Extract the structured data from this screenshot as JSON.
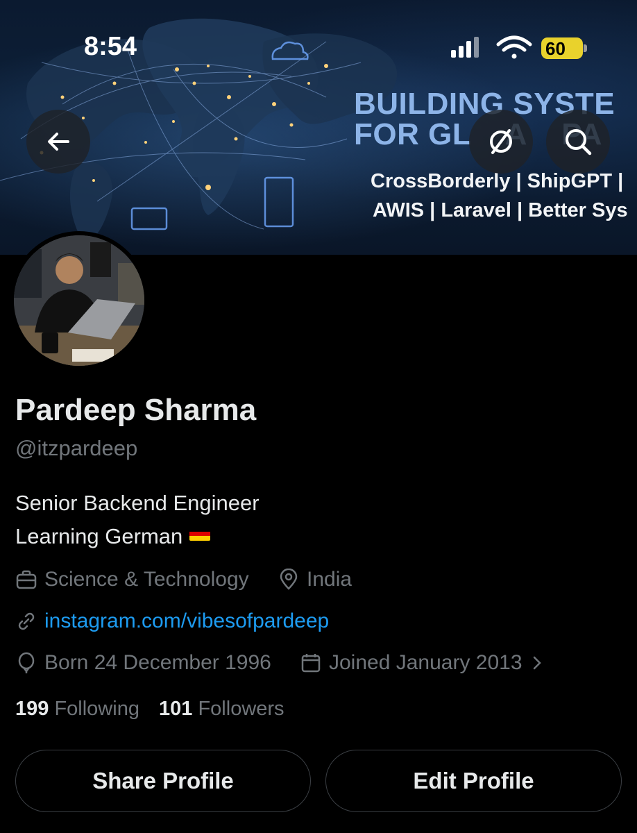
{
  "status_bar": {
    "time": "8:54",
    "battery": "60"
  },
  "banner": {
    "title_line1": "BUILDING SYSTE",
    "title_line2": "FOR GL    A    PA",
    "subtitle_line1": "CrossBorderly | ShipGPT |",
    "subtitle_line2": "AWIS | Laravel | Better Sys"
  },
  "profile": {
    "name": "Pardeep Sharma",
    "handle": "@itzpardeep",
    "bio_line1": "Senior Backend Engineer",
    "bio_line2": "Learning German",
    "category": "Science & Technology",
    "location": "India",
    "link": "instagram.com/vibesofpardeep",
    "born": "Born 24 December 1996",
    "joined": "Joined January 2013"
  },
  "stats": {
    "following_count": "199",
    "following_label": "Following",
    "followers_count": "101",
    "followers_label": "Followers"
  },
  "actions": {
    "share": "Share Profile",
    "edit": "Edit Profile"
  },
  "icons": {
    "back": "arrow-left-icon",
    "filter": "circle-slash-icon",
    "search": "search-icon",
    "category": "briefcase-icon",
    "location": "location-pin-icon",
    "link": "link-icon",
    "born": "balloon-icon",
    "joined": "calendar-icon"
  },
  "colors": {
    "background": "#000000",
    "text": "#e7e9ea",
    "muted": "#71767b",
    "link": "#1d9bf0",
    "battery": "#e9d22c"
  }
}
